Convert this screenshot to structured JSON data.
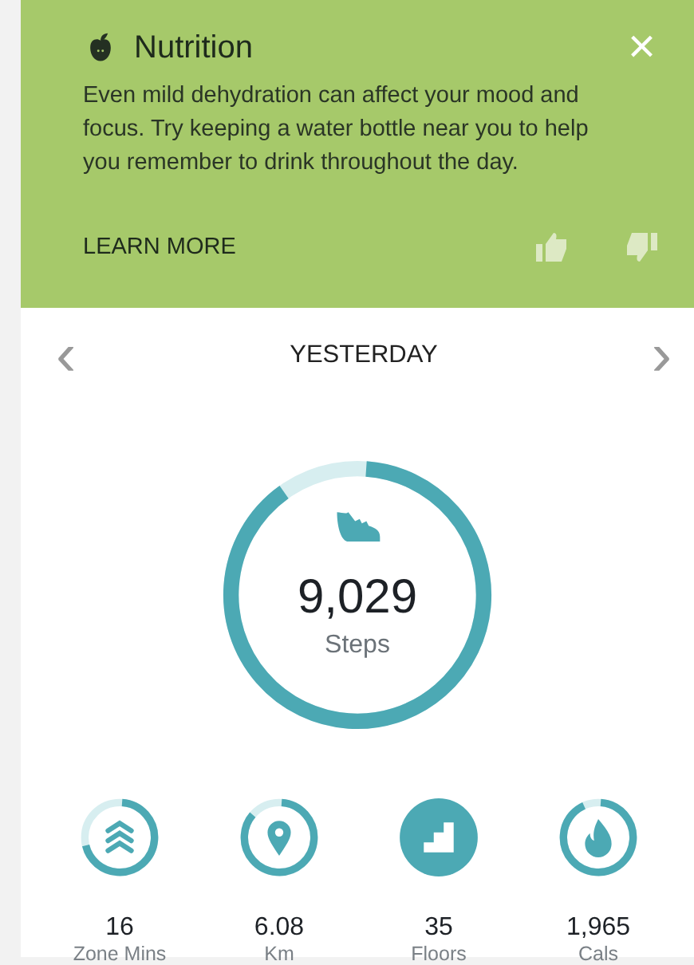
{
  "tip": {
    "title": "Nutrition",
    "close": "×",
    "body": "Even mild dehydration can affect your mood and focus. Try keeping a water bottle near you to help you remember to drink throughout the day.",
    "link": "LEARN MORE"
  },
  "day": {
    "prev": "‹",
    "label": "YESTERDAY",
    "next": "›"
  },
  "steps": {
    "value": "9,029",
    "unit": "Steps",
    "level": 0.89
  },
  "stats": [
    {
      "kind": "zone",
      "value": "16",
      "unit": "Zone Mins",
      "level": 0.7
    },
    {
      "kind": "distance",
      "value": "6.08",
      "unit": "Km",
      "level": 0.85
    },
    {
      "kind": "floors",
      "value": "35",
      "unit": "Floors",
      "level": 1
    },
    {
      "kind": "calories",
      "value": "1,965",
      "unit": "Cals",
      "level": 0.92
    }
  ]
}
